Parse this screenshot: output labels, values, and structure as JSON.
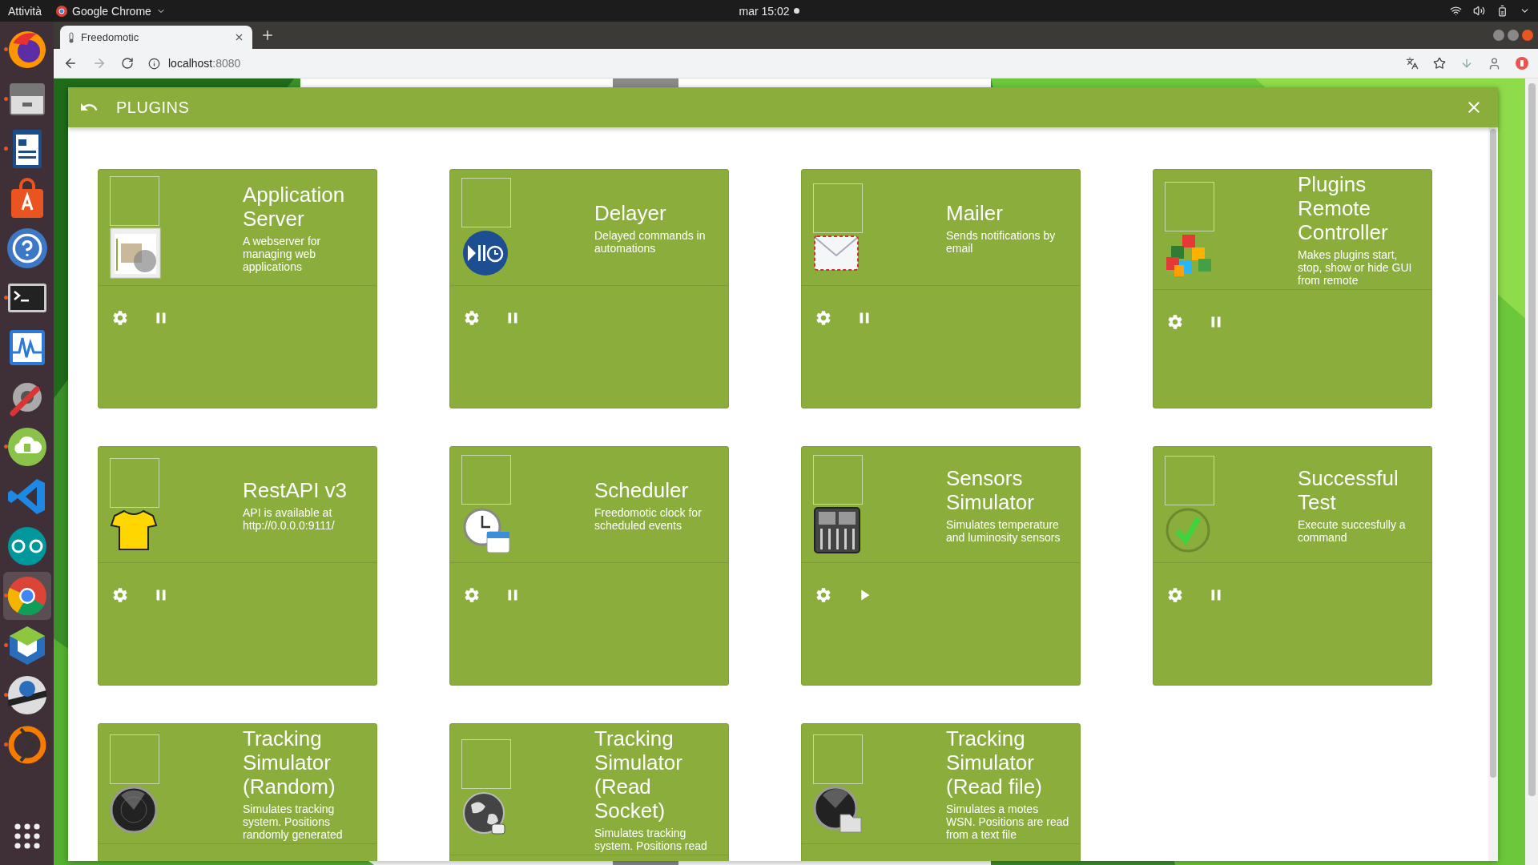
{
  "system_bar": {
    "activities": "Attività",
    "app_menu": "Google Chrome",
    "clock": "mar 15:02"
  },
  "dock": {
    "items": [
      {
        "running": true,
        "selected": false
      },
      {
        "running": true,
        "selected": false
      },
      {
        "running": true,
        "selected": false
      },
      {
        "running": false,
        "selected": false
      },
      {
        "running": false,
        "selected": false
      },
      {
        "running": true,
        "selected": false
      },
      {
        "running": false,
        "selected": false
      },
      {
        "running": false,
        "selected": false
      },
      {
        "running": true,
        "selected": false
      },
      {
        "running": false,
        "selected": false
      },
      {
        "running": false,
        "selected": false
      },
      {
        "running": true,
        "selected": true
      },
      {
        "running": true,
        "selected": false
      },
      {
        "running": true,
        "selected": false
      },
      {
        "running": true,
        "selected": false
      }
    ]
  },
  "browser": {
    "tab": {
      "title": "Freedomotic"
    },
    "address": {
      "host": "localhost",
      "port": ":8080"
    }
  },
  "dialog": {
    "title": "PLUGINS",
    "plugins": [
      {
        "name": "Application Server",
        "description": "A webserver for managing web applications",
        "running": true
      },
      {
        "name": "Delayer",
        "description": "Delayed commands in automations",
        "running": true
      },
      {
        "name": "Mailer",
        "description": "Sends notifications by email",
        "running": true
      },
      {
        "name": "Plugins Remote Controller",
        "description": "Makes plugins start, stop, show or hide GUI from remote",
        "running": true
      },
      {
        "name": "RestAPI v3",
        "description": "API is available at http://0.0.0.0:9111/",
        "running": true
      },
      {
        "name": "Scheduler",
        "description": "Freedomotic clock for scheduled events",
        "running": true
      },
      {
        "name": "Sensors Simulator",
        "description": "Simulates temperature and luminosity sensors",
        "running": false
      },
      {
        "name": "Successful Test",
        "description": "Execute succesfully a command",
        "running": true
      },
      {
        "name": "Tracking Simulator (Random)",
        "description": "Simulates tracking system. Positions randomly generated"
      },
      {
        "name": "Tracking Simulator (Read Socket)",
        "description": "Simulates tracking system. Positions read"
      },
      {
        "name": "Tracking Simulator (Read file)",
        "description": "Simulates a motes WSN. Positions are read from a text file"
      }
    ]
  }
}
